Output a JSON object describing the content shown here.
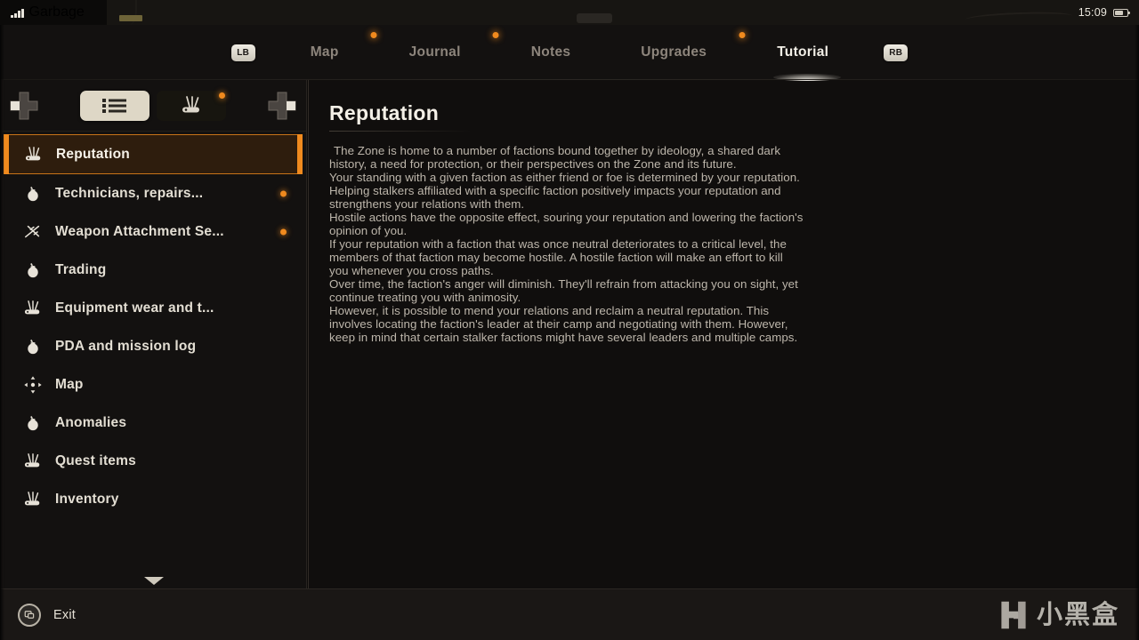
{
  "statusbar": {
    "signal_icon": "signal-bars-icon",
    "carrier": "Garbage",
    "time": "15:09",
    "battery_icon": "battery-icon"
  },
  "topnav": {
    "left_bumper": "LB",
    "right_bumper": "RB",
    "tabs": [
      {
        "label": "Map",
        "active": false,
        "notification": false
      },
      {
        "label": "Journal",
        "active": false,
        "notification": true
      },
      {
        "label": "Notes",
        "active": false,
        "notification": true
      },
      {
        "label": "Upgrades",
        "active": false,
        "notification": false
      },
      {
        "label": "Tutorial",
        "active": true,
        "notification": true
      }
    ]
  },
  "sidebar": {
    "dpad_left_icon": "dpad-left-icon",
    "dpad_right_icon": "dpad-right-icon",
    "view_toggles": [
      {
        "icon": "list-view-icon",
        "active": true,
        "notification": false
      },
      {
        "icon": "multitool-icon",
        "active": false,
        "notification": true
      }
    ],
    "scroll_down_icon": "chevron-down-icon",
    "items": [
      {
        "label": "Reputation",
        "icon": "multitool-icon",
        "selected": true,
        "notification": false
      },
      {
        "label": "Technicians, repairs...",
        "icon": "pouch-icon",
        "selected": false,
        "notification": true
      },
      {
        "label": "Weapon Attachment Se...",
        "icon": "attachment-icon",
        "selected": false,
        "notification": true
      },
      {
        "label": "Trading",
        "icon": "pouch-icon",
        "selected": false,
        "notification": false
      },
      {
        "label": "Equipment wear and t...",
        "icon": "multitool-icon",
        "selected": false,
        "notification": false
      },
      {
        "label": "PDA and mission log",
        "icon": "pouch-icon",
        "selected": false,
        "notification": false
      },
      {
        "label": "Map",
        "icon": "map-move-icon",
        "selected": false,
        "notification": false
      },
      {
        "label": "Anomalies",
        "icon": "pouch-icon",
        "selected": false,
        "notification": false
      },
      {
        "label": "Quest items",
        "icon": "multitool-icon",
        "selected": false,
        "notification": false
      },
      {
        "label": "Inventory",
        "icon": "multitool-icon",
        "selected": false,
        "notification": false
      }
    ]
  },
  "content": {
    "title": "Reputation",
    "paragraphs": [
      "The Zone is home to a number of factions bound together by ideology, a shared dark history, a need for protection, or their perspectives on the Zone and its future.",
      "Your standing with a given faction as either friend or foe is determined by your reputation. Helping stalkers affiliated with a specific faction positively impacts your reputation and strengthens your relations with them.",
      "Hostile actions have the opposite effect, souring your reputation and lowering the faction's opinion of you.",
      "If your reputation with a faction that was once neutral deteriorates to a critical level, the members of that faction may become hostile. A hostile faction will make an effort to kill you whenever you cross paths.",
      "Over time, the faction's anger will diminish. They'll refrain from attacking you on sight, yet continue treating you with animosity.",
      "However, it is possible to mend your relations and reclaim a neutral reputation. This involves locating the faction's leader at their camp and negotiating with them. However, keep in mind that certain stalker factions might have several leaders and multiple camps."
    ]
  },
  "footer": {
    "exit_label": "Exit",
    "exit_icon": "gamepad-button-icon"
  },
  "watermark": {
    "logo_icon": "xiaoheihe-logo-icon",
    "text": "小黑盒"
  },
  "colors": {
    "accent_orange": "#f08a1e",
    "selected_fill": "#2e1d0d",
    "selected_border": "#c87418",
    "text_primary": "#e3ded3",
    "text_body": "#bdb6ab",
    "text_muted": "#8d857c",
    "panel_bg": "#131110",
    "content_bg": "#100e0d",
    "toggle_active_bg": "#ded7c6"
  }
}
